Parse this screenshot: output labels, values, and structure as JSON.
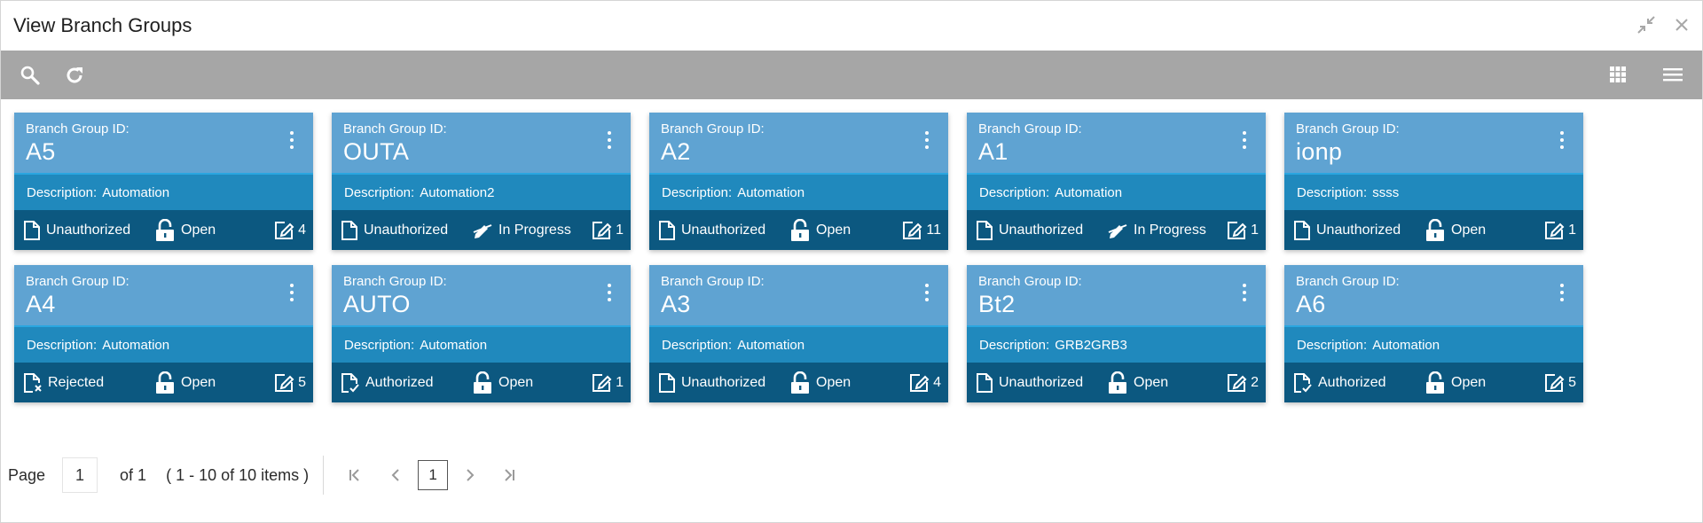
{
  "window": {
    "title": "View Branch Groups"
  },
  "labels": {
    "branch_group_id": "Branch Group ID:",
    "description": "Description:"
  },
  "cards": [
    {
      "id": "A5",
      "description": "Automation",
      "auth": "Unauthorized",
      "auth_icon": "document-icon",
      "record": "Open",
      "record_icon": "unlock-icon",
      "count": "4"
    },
    {
      "id": "OUTA",
      "description": "Automation2",
      "auth": "Unauthorized",
      "auth_icon": "document-icon",
      "record": "In Progress",
      "record_icon": "pen-icon",
      "count": "1"
    },
    {
      "id": "A2",
      "description": "Automation",
      "auth": "Unauthorized",
      "auth_icon": "document-icon",
      "record": "Open",
      "record_icon": "unlock-icon",
      "count": "11"
    },
    {
      "id": "A1",
      "description": "Automation",
      "auth": "Unauthorized",
      "auth_icon": "document-icon",
      "record": "In Progress",
      "record_icon": "pen-icon",
      "count": "1"
    },
    {
      "id": "ionp",
      "description": "ssss",
      "auth": "Unauthorized",
      "auth_icon": "document-icon",
      "record": "Open",
      "record_icon": "unlock-icon",
      "count": "1"
    },
    {
      "id": "A4",
      "description": "Automation",
      "auth": "Rejected",
      "auth_icon": "document-rejected-icon",
      "record": "Open",
      "record_icon": "unlock-icon",
      "count": "5"
    },
    {
      "id": "AUTO",
      "description": "Automation",
      "auth": "Authorized",
      "auth_icon": "document-authorized-icon",
      "record": "Open",
      "record_icon": "unlock-icon",
      "count": "1"
    },
    {
      "id": "A3",
      "description": "Automation",
      "auth": "Unauthorized",
      "auth_icon": "document-icon",
      "record": "Open",
      "record_icon": "unlock-icon",
      "count": "4"
    },
    {
      "id": "Bt2",
      "description": "GRB2GRB3",
      "auth": "Unauthorized",
      "auth_icon": "document-icon",
      "record": "Open",
      "record_icon": "unlock-icon",
      "count": "2"
    },
    {
      "id": "A6",
      "description": "Automation",
      "auth": "Authorized",
      "auth_icon": "document-authorized-icon",
      "record": "Open",
      "record_icon": "unlock-icon",
      "count": "5"
    }
  ],
  "pager": {
    "page_label": "Page",
    "page_value": "1",
    "of_label": "of 1",
    "items_label": "( 1 - 10 of 10 items )",
    "current": "1"
  },
  "colors": {
    "card_top": "#5fa3d2",
    "card_mid": "#2089bd",
    "card_bottom": "#0c5880",
    "toolbar": "#a6a6a6"
  }
}
